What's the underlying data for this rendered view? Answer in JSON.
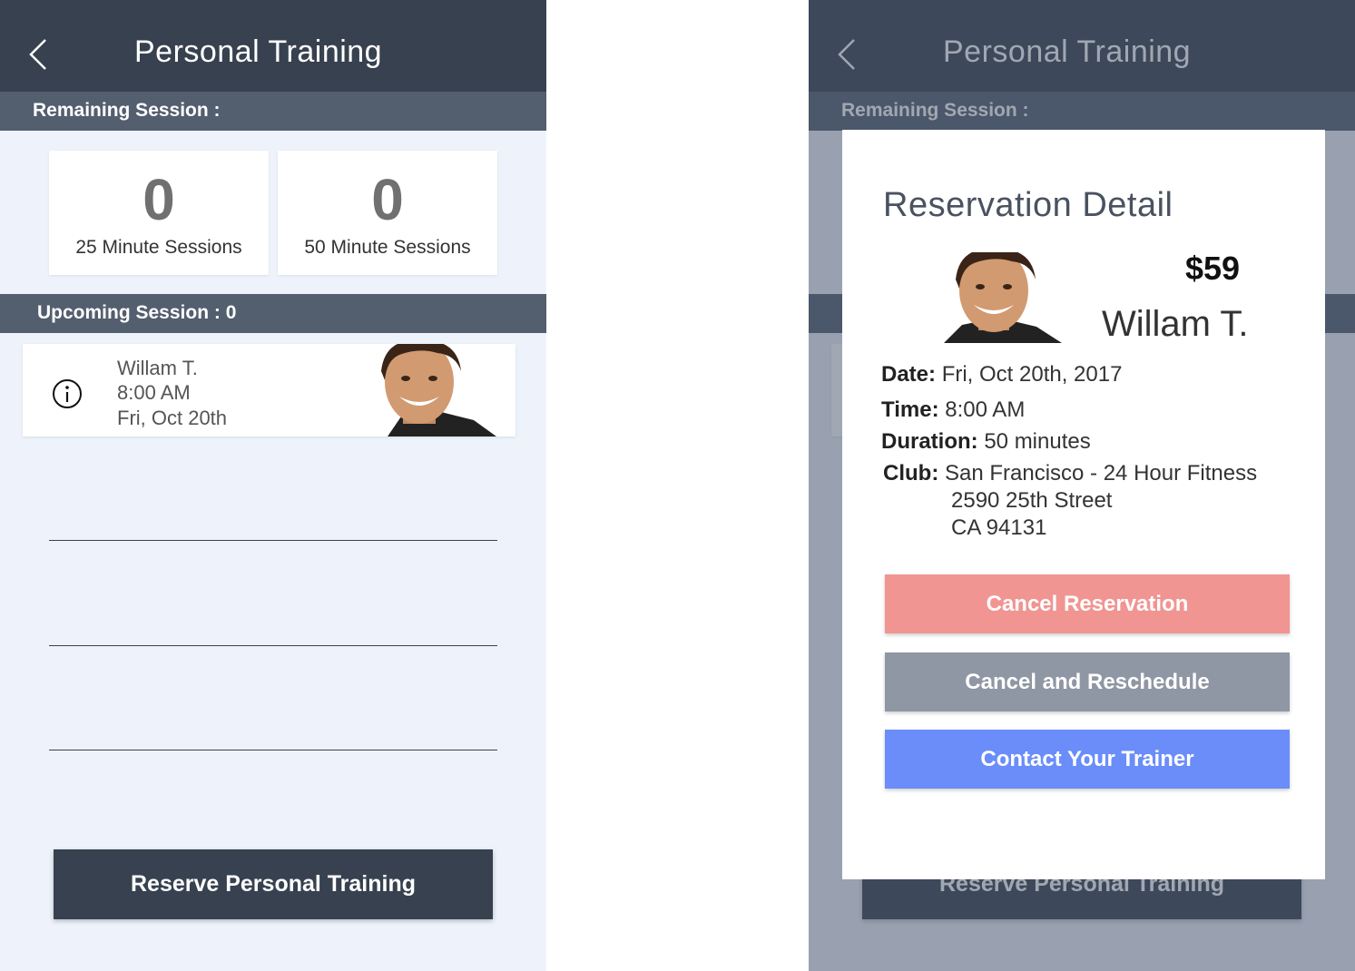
{
  "left": {
    "header": {
      "title": "Personal Training"
    },
    "remaining_label": "Remaining Session :",
    "counts": [
      {
        "value": "0",
        "label": "25 Minute Sessions"
      },
      {
        "value": "0",
        "label": "50 Minute Sessions"
      }
    ],
    "upcoming_label": "Upcoming Session : 0",
    "session": {
      "trainer": "Willam T.",
      "time": "8:00 AM",
      "date": "Fri, Oct 20th"
    },
    "reserve_label": "Reserve Personal Training"
  },
  "right": {
    "header": {
      "title": "Personal Training"
    },
    "remaining_label": "Remaining Session :",
    "reserve_label": "Reserve Personal Training",
    "modal": {
      "title": "Reservation Detail",
      "price": "$59",
      "trainer": "Willam T.",
      "date_label": "Date:",
      "date": "Fri, Oct 20th, 2017",
      "time_label": "Time:",
      "time": "8:00 AM",
      "duration_label": "Duration:",
      "duration": "50 minutes",
      "club_label": "Club:",
      "club_name": "San Francisco - 24 Hour Fitness",
      "club_street": "2590 25th Street",
      "club_city": "CA 94131",
      "buttons": {
        "cancel": "Cancel Reservation",
        "reschedule": "Cancel and Reschedule",
        "contact": "Contact Your Trainer"
      }
    }
  },
  "colors": {
    "header_bg": "#37414f",
    "section_bg": "#535e6e",
    "screen_bg": "#eef3fb",
    "cancel_btn": "#f09592",
    "reschedule_btn": "#8f96a4",
    "contact_btn": "#6a8dfa"
  }
}
